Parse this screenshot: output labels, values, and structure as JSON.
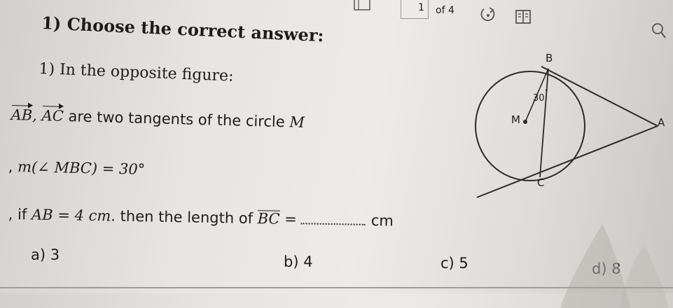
{
  "toolbar": {
    "page_number": "1",
    "page_total": "of 4",
    "icons": [
      "sidebar-toggle-icon",
      "rotate-icon",
      "book-icon",
      "search-icon"
    ]
  },
  "section_title": "1) Choose the correct answer:",
  "question": {
    "intro": "1) In the opposite figure:",
    "vec_ab": "AB",
    "vec_ac": "AC",
    "line1_text": " are two tangents of the circle ",
    "circle_name": "M",
    "line2_prefix": ", ",
    "angle_expr": "m(∠ MBC) = 30°",
    "line3_prefix": ", if ",
    "given_expr": "AB = 4 cm",
    "line3_middle": ". then the length of ",
    "segment": "BC",
    "equals": " =",
    "unit": "cm"
  },
  "options": [
    {
      "key": "a",
      "label": "a) 3"
    },
    {
      "key": "b",
      "label": "b) 4"
    },
    {
      "key": "c",
      "label": "c) 5"
    },
    {
      "key": "d",
      "label": "d) 8"
    }
  ],
  "figure": {
    "labels": {
      "B": "B",
      "A": "A",
      "C": "C",
      "M": "M",
      "angle": "30"
    }
  }
}
